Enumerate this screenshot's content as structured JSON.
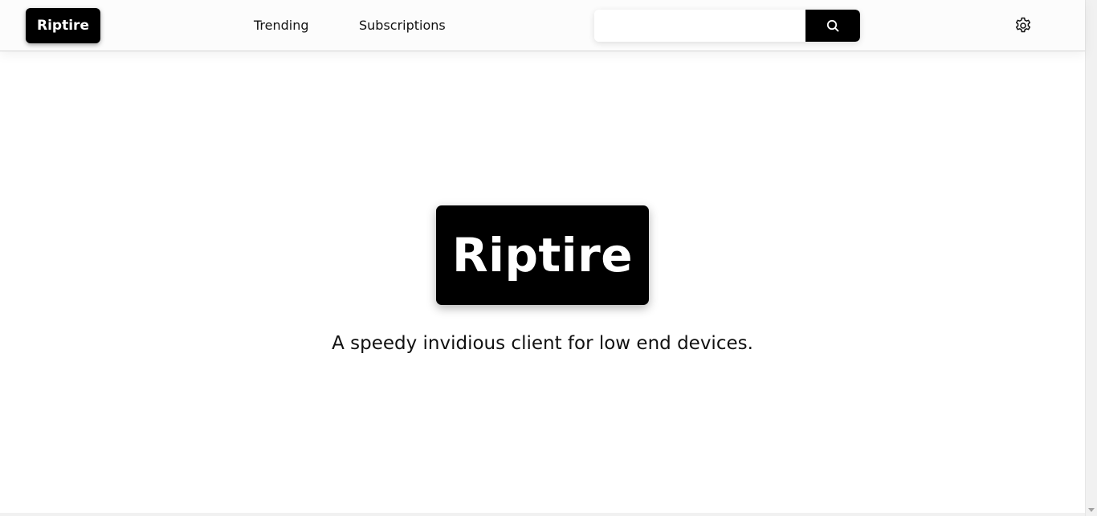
{
  "header": {
    "brand": "Riptire",
    "nav": {
      "trending": "Trending",
      "subscriptions": "Subscriptions"
    },
    "search": {
      "value": "",
      "placeholder": ""
    },
    "icons": {
      "search": "search-icon",
      "settings": "gear-icon"
    }
  },
  "hero": {
    "logo_text": "Riptire",
    "tagline": "A speedy invidious client for low end devices."
  },
  "colors": {
    "accent": "#000000",
    "text": "#111111",
    "background": "#ffffff"
  }
}
